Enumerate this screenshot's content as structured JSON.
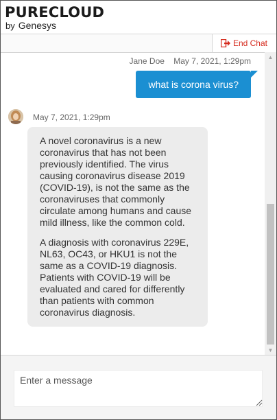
{
  "brand": {
    "name": "PURECLOUD",
    "by": "by",
    "company": "Genesys"
  },
  "toolbar": {
    "end_chat_label": "End Chat",
    "end_chat_icon": "sign-out-icon",
    "end_chat_color": "#d52b1e"
  },
  "messages": [
    {
      "direction": "outgoing",
      "sender": "Jane Doe",
      "timestamp": "May 7, 2021, 1:29pm",
      "text": "what is corona virus?",
      "bubble_color": "#1b8fd2"
    },
    {
      "direction": "incoming",
      "timestamp": "May 7, 2021, 1:29pm",
      "avatar_icon": "agent-avatar-icon",
      "paragraphs": [
        "A novel coronavirus is a new coronavirus that has not been previously identified. The virus causing coronavirus disease 2019 (COVID-19), is not the same as the coronaviruses that commonly circulate among humans and cause mild illness, like the common cold.",
        "A diagnosis with coronavirus 229E, NL63, OC43, or HKU1 is not the same as a COVID-19 diagnosis. Patients with COVID-19 will be evaluated and cared for differently than patients with common coronavirus diagnosis."
      ]
    }
  ],
  "composer": {
    "placeholder": "Enter a message",
    "value": ""
  }
}
